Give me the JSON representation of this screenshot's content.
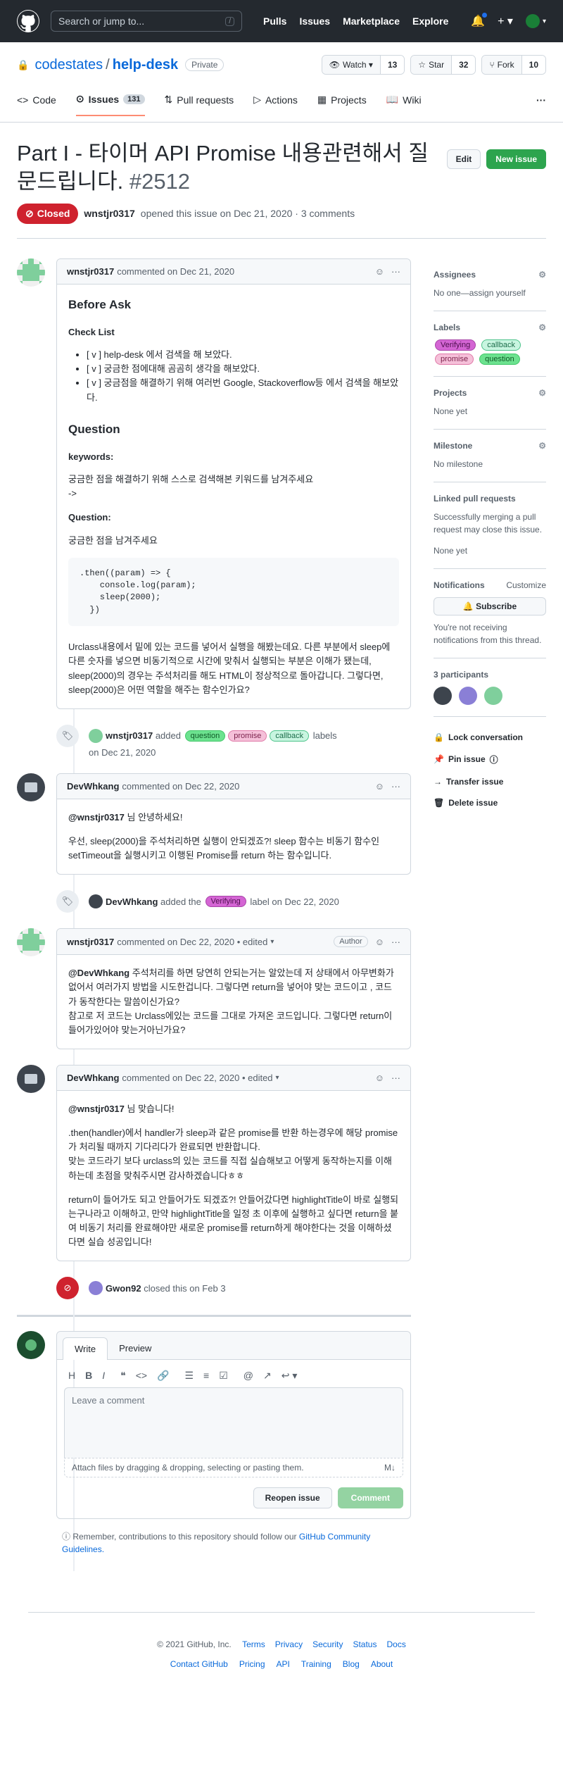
{
  "header": {
    "search_placeholder": "Search or jump to...",
    "slash_key": "/",
    "nav": [
      "Pulls",
      "Issues",
      "Marketplace",
      "Explore"
    ]
  },
  "repo": {
    "owner": "codestates",
    "separator": "/",
    "name": "help-desk",
    "visibility": "Private",
    "watch_label": "Watch",
    "watch_count": "13",
    "star_label": "Star",
    "star_count": "32",
    "fork_label": "Fork",
    "fork_count": "10",
    "tabs": [
      {
        "label": "Code"
      },
      {
        "label": "Issues",
        "count": "131"
      },
      {
        "label": "Pull requests"
      },
      {
        "label": "Actions"
      },
      {
        "label": "Projects"
      },
      {
        "label": "Wiki"
      }
    ]
  },
  "issue": {
    "title": "Part I - 타이머 API Promise 내용관련해서 질문드립니다.",
    "number": "#2512",
    "edit_label": "Edit",
    "new_issue_label": "New issue",
    "state": "Closed",
    "author": "wnstjr0317",
    "meta_text": "opened this issue on Dec 21, 2020 · 3 comments"
  },
  "comments": [
    {
      "author": "wnstjr0317",
      "meta": "commented on Dec 21, 2020",
      "h_before_ask": "Before Ask",
      "h_checklist": "Check List",
      "checklist": [
        "[ v ] help-desk 에서 검색을 해 보았다.",
        "[ v ] 궁금한 점에대해 곰곰히 생각을 해보았다.",
        "[ v ] 궁금점을 해결하기 위해 여러번 Google, Stackoverflow등 에서 검색을 해보았다."
      ],
      "h_question": "Question",
      "h_keywords": "keywords:",
      "keywords_text": "궁금한 점을 해결하기 위해 스스로 검색해본 키워드를 남겨주세요",
      "arrow": "->",
      "h_question2": "Question:",
      "question_text": "궁금한 점을 남겨주세요",
      "code": ".then((param) => {\n    console.log(param);\n    sleep(2000);\n  })",
      "closing": "Urclass내용에서 밑에 있는 코드를 넣어서 실행을 해봤는데요. 다른 부분에서 sleep에 다른 숫자를 넣으면 비동기적으로 시간에 맞춰서 실행되는 부분은 이해가 됐는데, sleep(2000)의 경우는 주석처리를 해도 HTML이 정상적으로 돌아갑니다. 그렇다면, sleep(2000)은 어떤 역할을 해주는 함수인가요?"
    },
    {
      "author": "DevWhkang",
      "meta": "commented on Dec 22, 2020",
      "mention": "@wnstjr0317",
      "greeting": " 님 안녕하세요!",
      "body": "우선, sleep(2000)을 주석처리하면 실행이 안되겠죠?! sleep 함수는 비동기 함수인 setTimeout을 실행시키고 이행된 Promise를 return 하는 함수입니다."
    },
    {
      "author": "wnstjr0317",
      "meta": "commented on Dec 22, 2020 • edited",
      "role": "Author",
      "mention": "@DevWhkang",
      "body": " 주석처리를 하면 당연히 안되는거는 알았는데 저 상태에서 아무변화가 없어서 여러가지 방법을 시도한겁니다. 그렇다면 return을 넣어야 맞는 코드이고 , 코드가 동작한다는 말씀이신가요?",
      "body2": "참고로 저 코드는 Urclass에있는 코드를 그대로 가져온 코드입니다. 그렇다면 return이 들어가있어야 맞는거아닌가요?"
    },
    {
      "author": "DevWhkang",
      "meta": "commented on Dec 22, 2020 • edited",
      "mention": "@wnstjr0317",
      "greeting": " 님 맞습니다!",
      "p1": ".then(handler)에서 handler가 sleep과 같은 promise를 반환 하는경우에 해당 promise가 처리될 때까지 기다리다가 완료되면 반환합니다.",
      "p1b": "맞는 코드라기 보다 urclass의 있는 코드를 직접 실습해보고 어떻게 동작하는지를 이해하는데 초점을 맞춰주시면 감사하겠습니다ㅎㅎ",
      "p2": "return이 들어가도 되고 안들어가도 되겠죠?! 안들어갔다면 highlightTitle이 바로 실행되는구나라고 이해하고, 만약 highlightTitle을 일정 초 이후에 실행하고 싶다면 return을 붙여 비동기 처리를 완료해야만 새로운 promise를 return하게 해야한다는 것을 이해하셨다면 실습 성공입니다!"
    }
  ],
  "events": {
    "labels_added": {
      "actor": "wnstjr0317",
      "verb": "added",
      "labels": [
        "question",
        "promise",
        "callback"
      ],
      "suffix": "labels",
      "date": "on Dec 21, 2020"
    },
    "label_added": {
      "actor": "DevWhkang",
      "verb": "added the",
      "label": "Verifying",
      "suffix": "label on Dec 22, 2020"
    },
    "closed": {
      "actor": "Gwon92",
      "text": "closed this on Feb 3"
    }
  },
  "sidebar": {
    "assignees_title": "Assignees",
    "assignees_text": "No one—assign yourself",
    "labels_title": "Labels",
    "labels": [
      "Verifying",
      "callback",
      "promise",
      "question"
    ],
    "projects_title": "Projects",
    "projects_text": "None yet",
    "milestone_title": "Milestone",
    "milestone_text": "No milestone",
    "linked_title": "Linked pull requests",
    "linked_text": "Successfully merging a pull request may close this issue.",
    "linked_none": "None yet",
    "notifications_title": "Notifications",
    "customize": "Customize",
    "subscribe": "Subscribe",
    "notif_text": "You're not receiving notifications from this thread.",
    "participants_title": "3 participants",
    "actions": [
      "Lock conversation",
      "Pin issue",
      "Transfer issue",
      "Delete issue"
    ]
  },
  "editor": {
    "write_tab": "Write",
    "preview_tab": "Preview",
    "placeholder": "Leave a comment",
    "attach_text": "Attach files by dragging & dropping, selecting or pasting them.",
    "reopen": "Reopen issue",
    "comment": "Comment",
    "remember": "Remember, contributions to this repository should follow our",
    "guidelines": "GitHub Community Guidelines."
  },
  "footer": {
    "copyright": "© 2021 GitHub, Inc.",
    "links1": [
      "Terms",
      "Privacy",
      "Security",
      "Status",
      "Docs"
    ],
    "links2": [
      "Contact GitHub",
      "Pricing",
      "API",
      "Training",
      "Blog",
      "About"
    ]
  }
}
